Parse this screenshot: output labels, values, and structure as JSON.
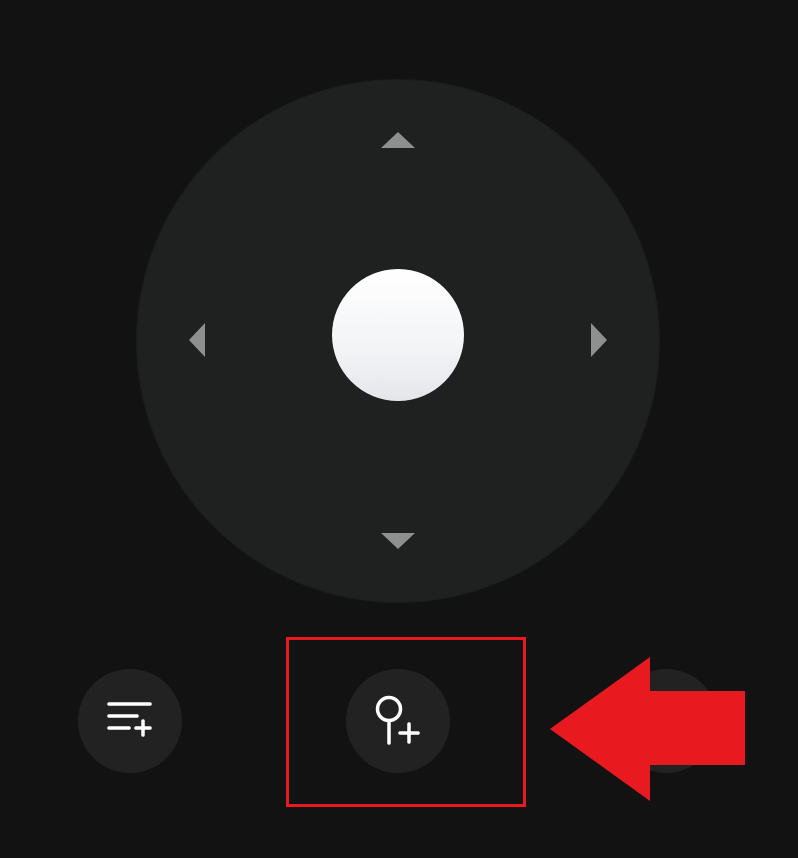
{
  "remote": {
    "dpad": {
      "up_icon": "triangle-up-icon",
      "down_icon": "triangle-down-icon",
      "left_icon": "triangle-left-icon",
      "right_icon": "triangle-right-icon",
      "center_icon": "select-circle"
    },
    "bottom_buttons": [
      {
        "icon": "playlist-add-icon"
      },
      {
        "icon": "pin-add-icon"
      },
      {
        "icon": "circle-button-icon"
      }
    ]
  },
  "annotation": {
    "highlight_color": "#e8191f",
    "arrow_color": "#e8191f",
    "target": "pin-add-button"
  },
  "colors": {
    "background": "#121212",
    "dpad": "#1f2121",
    "button": "#222222",
    "arrow": "#8e8f8f",
    "icon": "#ffffff"
  }
}
